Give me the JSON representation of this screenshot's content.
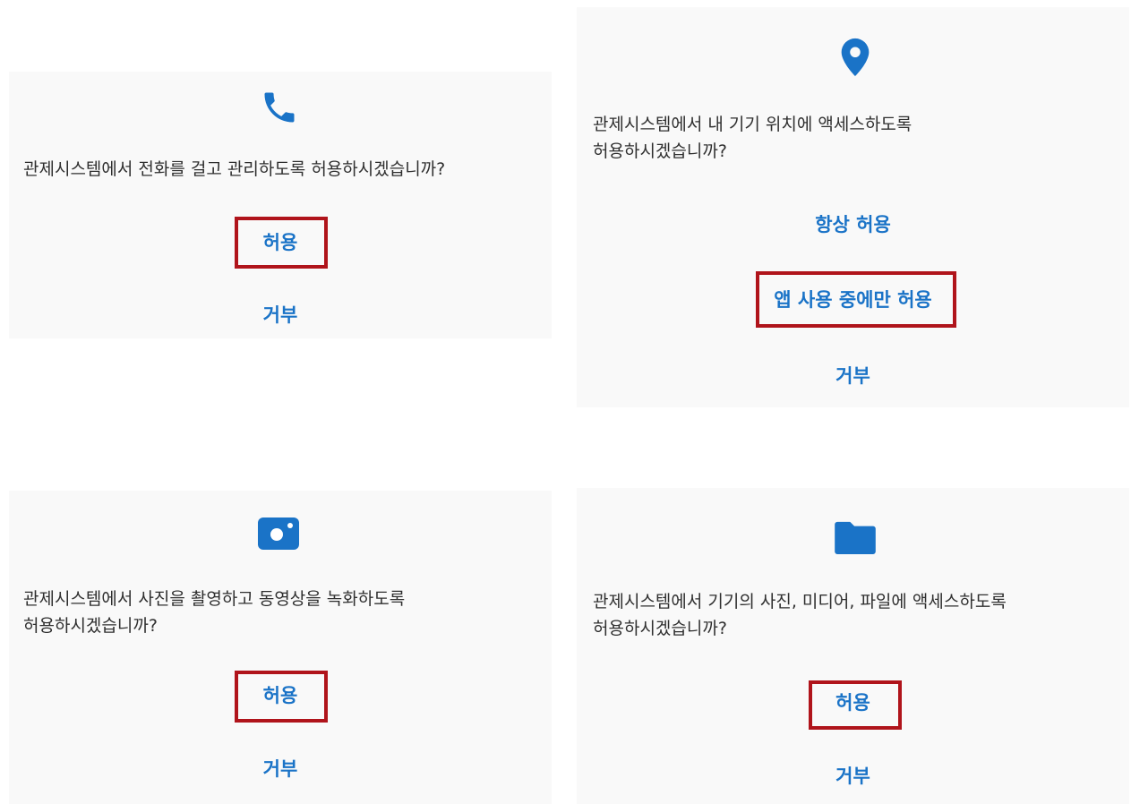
{
  "colors": {
    "accent": "#1a73c7",
    "highlight_border": "#b0141b",
    "panel_bg": "#f9f9f9",
    "text": "#2f2f2f"
  },
  "dialogs": [
    {
      "icon": "phone-icon",
      "message_lines": [
        "관제시스템에서 전화를 걸고 관리하도록 허용하시겠습니까?"
      ],
      "buttons": [
        "허용",
        "거부"
      ],
      "highlighted_button": "허용"
    },
    {
      "icon": "location-pin-icon",
      "message_lines": [
        "관제시스템에서 내 기기 위치에 액세스하도록",
        "허용하시겠습니까?"
      ],
      "buttons": [
        "항상 허용",
        "앱 사용 중에만 허용",
        "거부"
      ],
      "highlighted_button": "앱 사용 중에만 허용"
    },
    {
      "icon": "camera-icon",
      "message_lines": [
        "관제시스템에서 사진을 촬영하고 동영상을 녹화하도록",
        "허용하시겠습니까?"
      ],
      "buttons": [
        "허용",
        "거부"
      ],
      "highlighted_button": "허용"
    },
    {
      "icon": "folder-icon",
      "message_lines": [
        "관제시스템에서 기기의 사진, 미디어, 파일에 액세스하도록",
        "허용하시겠습니까?"
      ],
      "buttons": [
        "허용",
        "거부"
      ],
      "highlighted_button": "허용"
    }
  ]
}
